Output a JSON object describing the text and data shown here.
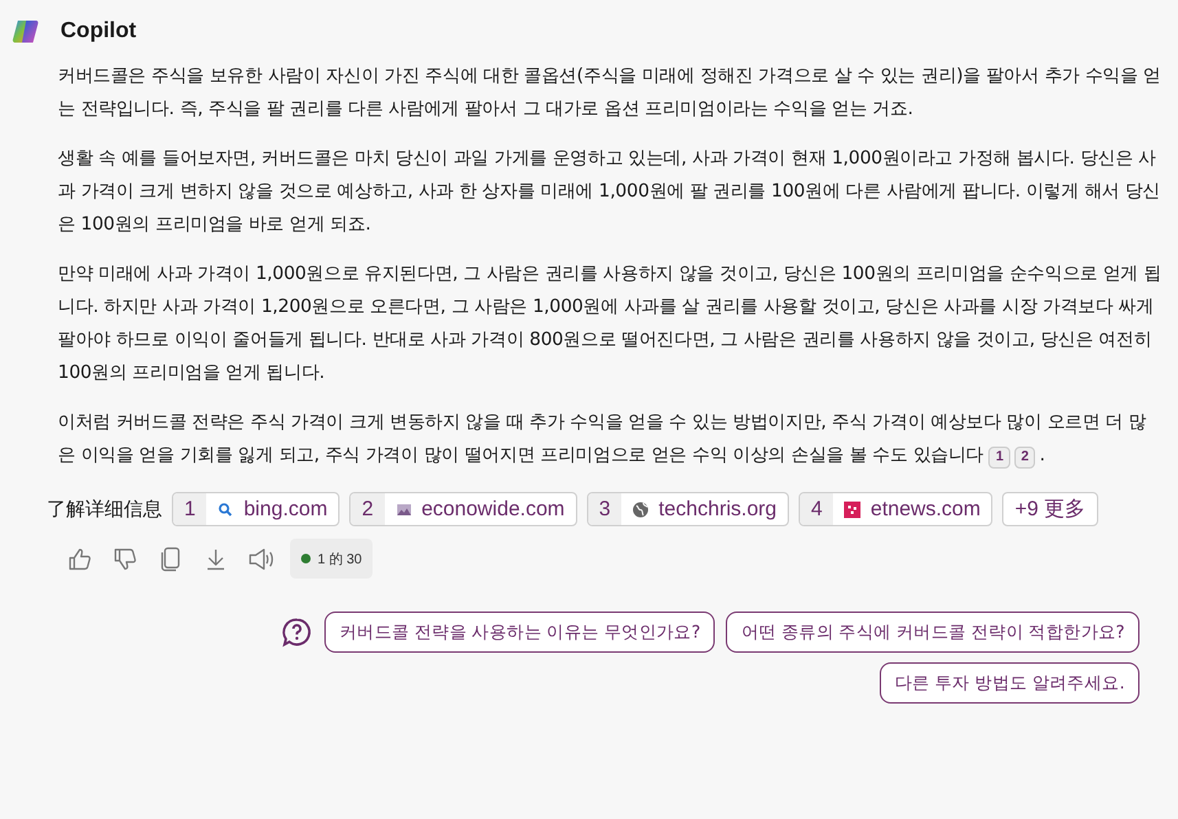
{
  "header": {
    "title": "Copilot"
  },
  "paragraphs": [
    {
      "text": "커버드콜은 주식을 보유한 사람이 자신이 가진 주식에 대한 콜옵션(주식을 미래에 정해진 가격으로 살 수 있는 권리)을 팔아서 추가 수익을 얻는 전략입니다. 즉, 주식을 팔 권리를 다른 사람에게 팔아서 그 대가로 옵션 프리미엄이라는 수익을 얻는 거죠."
    },
    {
      "text": "생활 속 예를 들어보자면, 커버드콜은 마치 당신이 과일 가게를 운영하고 있는데, 사과 가격이 현재 1,000원이라고 가정해 봅시다. 당신은 사과 가격이 크게 변하지 않을 것으로 예상하고, 사과 한 상자를 미래에 1,000원에 팔 권리를 100원에 다른 사람에게 팝니다. 이렇게 해서 당신은 100원의 프리미엄을 바로 얻게 되죠."
    },
    {
      "text": "만약 미래에 사과 가격이 1,000원으로 유지된다면, 그 사람은 권리를 사용하지 않을 것이고, 당신은 100원의 프리미엄을 순수익으로 얻게 됩니다. 하지만 사과 가격이 1,200원으로 오른다면, 그 사람은 1,000원에 사과를 살 권리를 사용할 것이고, 당신은 사과를 시장 가격보다 싸게 팔아야 하므로 이익이 줄어들게 됩니다. 반대로 사과 가격이 800원으로 떨어진다면, 그 사람은 권리를 사용하지 않을 것이고, 당신은 여전히 100원의 프리미엄을 얻게 됩니다."
    },
    {
      "text": "이처럼 커버드콜 전략은 주식 가격이 크게 변동하지 않을 때 추가 수익을 얻을 수 있는 방법이지만, 주식 가격이 예상보다 많이 오르면 더 많은 이익을 얻을 기회를 잃게 되고, 주식 가격이 많이 떨어지면 프리미엄으로 얻은 수익 이상의 손실을 볼 수도 있습니다",
      "citations": [
        "1",
        "2"
      ],
      "tail": "."
    }
  ],
  "sources": {
    "label": "了解详细信息",
    "items": [
      {
        "number": "1",
        "kind": "search",
        "domain": "bing.com"
      },
      {
        "number": "2",
        "kind": "image",
        "domain": "econowide.com"
      },
      {
        "number": "3",
        "kind": "globe",
        "domain": "techchris.org"
      },
      {
        "number": "4",
        "kind": "square",
        "domain": "etnews.com"
      }
    ],
    "more": "+9 更多"
  },
  "actions": {
    "counter": {
      "text": "1 的 30",
      "color": "#2e7d32"
    }
  },
  "suggestions": [
    "커버드콜 전략을 사용하는 이유는 무엇인가요?",
    "어떤 종류의 주식에 커버드콜 전략이 적합한가요?",
    "다른 투자 방법도 알려주세요."
  ]
}
